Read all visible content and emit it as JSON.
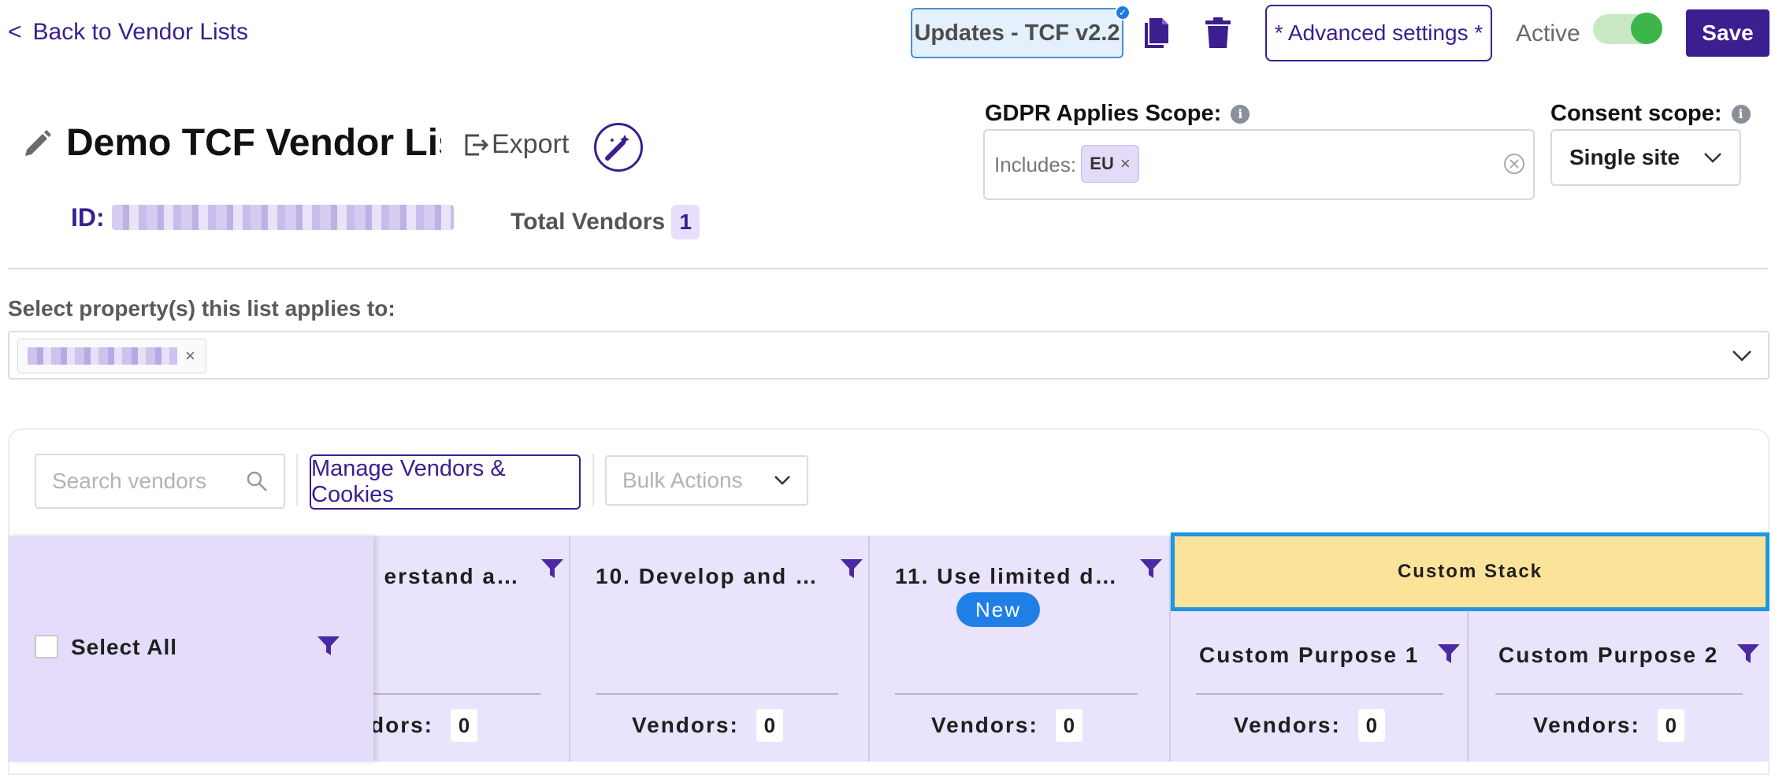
{
  "nav": {
    "back_label": "Back to Vendor Lists",
    "back_chevron": "<"
  },
  "toolbar": {
    "updates_label": "Updates - TCF v2.2",
    "advanced_label": "* Advanced settings *",
    "active_label": "Active",
    "active_on": true,
    "save_label": "Save",
    "icons": [
      "copy-icon",
      "trash-icon"
    ]
  },
  "header": {
    "title": "Demo TCF Vendor List",
    "export_label": "Export",
    "id_label": "ID:",
    "total_vendors_label": "Total Vendors",
    "total_vendors_count": "1"
  },
  "gdpr": {
    "label": "GDPR Applies Scope:",
    "includes_label": "Includes:",
    "tags": [
      "EU"
    ]
  },
  "consent": {
    "label": "Consent scope:",
    "value": "Single site"
  },
  "properties": {
    "label": "Select property(s) this list applies to:"
  },
  "table_toolbar": {
    "search_placeholder": "Search vendors",
    "manage_label": "Manage Vendors & Cookies",
    "bulk_placeholder": "Bulk Actions"
  },
  "table": {
    "select_all_label": "Select All",
    "vendors_label": "Vendors:",
    "new_badge": "New",
    "custom_stack_label": "Custom Stack",
    "columns": [
      {
        "title": "erstand a…",
        "vendors_label": "dors:",
        "count": "0"
      },
      {
        "title": "10. Develop and …",
        "count": "0"
      },
      {
        "title": "11. Use limited d…",
        "count": "0"
      },
      {
        "title": "Custom Purpose 1",
        "count": "0"
      },
      {
        "title": "Custom Purpose 2",
        "count": "0"
      }
    ]
  },
  "colors": {
    "brand": "#3b1e8f",
    "accent_blue": "#1f7fe6",
    "table_bg": "#e9e3fb",
    "custom_stack": "#fbe39a",
    "toggle_on": "#3cb54a"
  }
}
